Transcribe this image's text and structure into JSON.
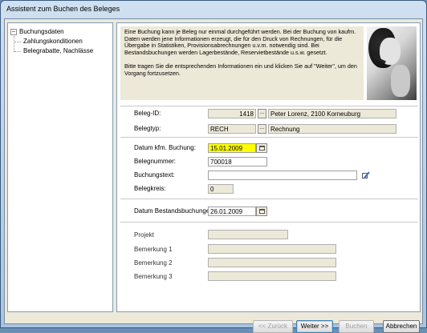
{
  "window": {
    "title": "Assistent zum Buchen des Beleges"
  },
  "tree": {
    "root": "Buchungsdaten",
    "toggle": "−",
    "children": [
      "Zahlungskonditionen",
      "Belegrabatte, Nachlässe"
    ]
  },
  "info": {
    "paragraph1": "Eine Buchung kann je Beleg nur einmal durchgeführt werden. Bei der Buchung von kaufm. Daten werden jene Informationen erzeugt, die für den Druck von Rechnungen, für die Übergabe in Statistiken, Provisionsabrechnungen u.v.m. notwendig sind. Bei Bestandsbuchungen werden Lagerbestände, Reservietbestände u.s.w. gesetzt.",
    "paragraph2": "Bitte tragen Sie die entsprechenden Informationen ein und klicken Sie auf \"Weiter\", um den Vorgang fortzusetzen."
  },
  "form": {
    "beleg_id": {
      "label": "Beleg-ID:",
      "value": "1418",
      "button": "...",
      "description": "Peter Lorenz, 2100  Korneuburg"
    },
    "belegtyp": {
      "label": "Belegtyp:",
      "value": "RECH",
      "button": "...",
      "description": "Rechnung"
    },
    "datum_buchung": {
      "label": "Datum kfm. Buchung:",
      "value": "15.01.2009"
    },
    "belegnummer": {
      "label": "Belegnummer:",
      "value": "700018"
    },
    "buchungstext": {
      "label": "Buchungstext:",
      "value": ""
    },
    "belegkreis": {
      "label": "Belegkreis:",
      "value": "0"
    },
    "datum_bestand": {
      "label": "Datum Bestandsbuchungen",
      "value": "26.01.2009"
    },
    "projekt": {
      "label": "Projekt",
      "value": ""
    },
    "bemerkung1": {
      "label": "Bemerkung 1",
      "value": ""
    },
    "bemerkung2": {
      "label": "Bemerkung 2",
      "value": ""
    },
    "bemerkung3": {
      "label": "Bemerkung 3",
      "value": ""
    }
  },
  "buttons": {
    "back": "<< Zurück",
    "next": "Weiter >>",
    "book": "Buchen",
    "cancel": "Abbrechen"
  }
}
